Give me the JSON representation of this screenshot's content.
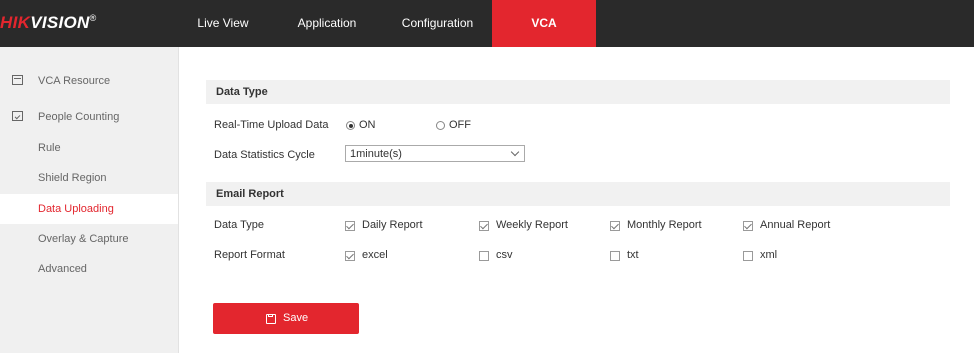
{
  "header": {
    "logo_red": "HIK",
    "logo_white": "VISION",
    "logo_mark": "®",
    "tabs": [
      {
        "label": "Live View"
      },
      {
        "label": "Application"
      },
      {
        "label": "Configuration"
      },
      {
        "label": "VCA",
        "active": true
      }
    ]
  },
  "sidebar": {
    "items": [
      {
        "label": "VCA Resource",
        "icon": "calendar-icon"
      },
      {
        "label": "People Counting",
        "icon": "checkbox-icon"
      },
      {
        "label": "Rule"
      },
      {
        "label": "Shield Region"
      },
      {
        "label": "Data Uploading",
        "active": true
      },
      {
        "label": "Overlay & Capture"
      },
      {
        "label": "Advanced"
      }
    ]
  },
  "data_type": {
    "title": "Data Type",
    "realtime_label": "Real-Time Upload Data",
    "on_label": "ON",
    "off_label": "OFF",
    "selected": "ON",
    "cycle_label": "Data Statistics Cycle",
    "cycle_value": "1minute(s)"
  },
  "email_report": {
    "title": "Email Report",
    "data_type_label": "Data Type",
    "report_types": [
      {
        "label": "Daily Report",
        "checked": true
      },
      {
        "label": "Weekly Report",
        "checked": true
      },
      {
        "label": "Monthly Report",
        "checked": true
      },
      {
        "label": "Annual Report",
        "checked": true
      }
    ],
    "format_label": "Report Format",
    "formats": [
      {
        "label": "excel",
        "checked": true
      },
      {
        "label": "csv",
        "checked": false
      },
      {
        "label": "txt",
        "checked": false
      },
      {
        "label": "xml",
        "checked": false
      }
    ]
  },
  "save": {
    "label": "Save"
  },
  "colors": {
    "accent": "#e3262e",
    "topbar": "#2a2a2a",
    "sidebar": "#f0f0f0"
  }
}
